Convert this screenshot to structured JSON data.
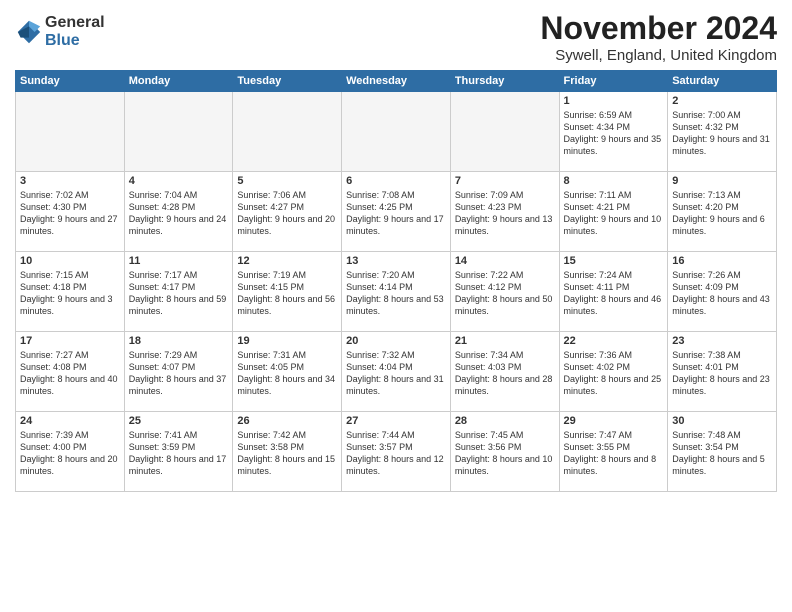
{
  "logo": {
    "general": "General",
    "blue": "Blue"
  },
  "title": "November 2024",
  "location": "Sywell, England, United Kingdom",
  "days_of_week": [
    "Sunday",
    "Monday",
    "Tuesday",
    "Wednesday",
    "Thursday",
    "Friday",
    "Saturday"
  ],
  "weeks": [
    [
      {
        "num": "",
        "info": "",
        "empty": true
      },
      {
        "num": "",
        "info": "",
        "empty": true
      },
      {
        "num": "",
        "info": "",
        "empty": true
      },
      {
        "num": "",
        "info": "",
        "empty": true
      },
      {
        "num": "",
        "info": "",
        "empty": true
      },
      {
        "num": "1",
        "info": "Sunrise: 6:59 AM\nSunset: 4:34 PM\nDaylight: 9 hours and 35 minutes."
      },
      {
        "num": "2",
        "info": "Sunrise: 7:00 AM\nSunset: 4:32 PM\nDaylight: 9 hours and 31 minutes."
      }
    ],
    [
      {
        "num": "3",
        "info": "Sunrise: 7:02 AM\nSunset: 4:30 PM\nDaylight: 9 hours and 27 minutes."
      },
      {
        "num": "4",
        "info": "Sunrise: 7:04 AM\nSunset: 4:28 PM\nDaylight: 9 hours and 24 minutes."
      },
      {
        "num": "5",
        "info": "Sunrise: 7:06 AM\nSunset: 4:27 PM\nDaylight: 9 hours and 20 minutes."
      },
      {
        "num": "6",
        "info": "Sunrise: 7:08 AM\nSunset: 4:25 PM\nDaylight: 9 hours and 17 minutes."
      },
      {
        "num": "7",
        "info": "Sunrise: 7:09 AM\nSunset: 4:23 PM\nDaylight: 9 hours and 13 minutes."
      },
      {
        "num": "8",
        "info": "Sunrise: 7:11 AM\nSunset: 4:21 PM\nDaylight: 9 hours and 10 minutes."
      },
      {
        "num": "9",
        "info": "Sunrise: 7:13 AM\nSunset: 4:20 PM\nDaylight: 9 hours and 6 minutes."
      }
    ],
    [
      {
        "num": "10",
        "info": "Sunrise: 7:15 AM\nSunset: 4:18 PM\nDaylight: 9 hours and 3 minutes."
      },
      {
        "num": "11",
        "info": "Sunrise: 7:17 AM\nSunset: 4:17 PM\nDaylight: 8 hours and 59 minutes."
      },
      {
        "num": "12",
        "info": "Sunrise: 7:19 AM\nSunset: 4:15 PM\nDaylight: 8 hours and 56 minutes."
      },
      {
        "num": "13",
        "info": "Sunrise: 7:20 AM\nSunset: 4:14 PM\nDaylight: 8 hours and 53 minutes."
      },
      {
        "num": "14",
        "info": "Sunrise: 7:22 AM\nSunset: 4:12 PM\nDaylight: 8 hours and 50 minutes."
      },
      {
        "num": "15",
        "info": "Sunrise: 7:24 AM\nSunset: 4:11 PM\nDaylight: 8 hours and 46 minutes."
      },
      {
        "num": "16",
        "info": "Sunrise: 7:26 AM\nSunset: 4:09 PM\nDaylight: 8 hours and 43 minutes."
      }
    ],
    [
      {
        "num": "17",
        "info": "Sunrise: 7:27 AM\nSunset: 4:08 PM\nDaylight: 8 hours and 40 minutes."
      },
      {
        "num": "18",
        "info": "Sunrise: 7:29 AM\nSunset: 4:07 PM\nDaylight: 8 hours and 37 minutes."
      },
      {
        "num": "19",
        "info": "Sunrise: 7:31 AM\nSunset: 4:05 PM\nDaylight: 8 hours and 34 minutes."
      },
      {
        "num": "20",
        "info": "Sunrise: 7:32 AM\nSunset: 4:04 PM\nDaylight: 8 hours and 31 minutes."
      },
      {
        "num": "21",
        "info": "Sunrise: 7:34 AM\nSunset: 4:03 PM\nDaylight: 8 hours and 28 minutes."
      },
      {
        "num": "22",
        "info": "Sunrise: 7:36 AM\nSunset: 4:02 PM\nDaylight: 8 hours and 25 minutes."
      },
      {
        "num": "23",
        "info": "Sunrise: 7:38 AM\nSunset: 4:01 PM\nDaylight: 8 hours and 23 minutes."
      }
    ],
    [
      {
        "num": "24",
        "info": "Sunrise: 7:39 AM\nSunset: 4:00 PM\nDaylight: 8 hours and 20 minutes."
      },
      {
        "num": "25",
        "info": "Sunrise: 7:41 AM\nSunset: 3:59 PM\nDaylight: 8 hours and 17 minutes."
      },
      {
        "num": "26",
        "info": "Sunrise: 7:42 AM\nSunset: 3:58 PM\nDaylight: 8 hours and 15 minutes."
      },
      {
        "num": "27",
        "info": "Sunrise: 7:44 AM\nSunset: 3:57 PM\nDaylight: 8 hours and 12 minutes."
      },
      {
        "num": "28",
        "info": "Sunrise: 7:45 AM\nSunset: 3:56 PM\nDaylight: 8 hours and 10 minutes."
      },
      {
        "num": "29",
        "info": "Sunrise: 7:47 AM\nSunset: 3:55 PM\nDaylight: 8 hours and 8 minutes."
      },
      {
        "num": "30",
        "info": "Sunrise: 7:48 AM\nSunset: 3:54 PM\nDaylight: 8 hours and 5 minutes."
      }
    ]
  ]
}
